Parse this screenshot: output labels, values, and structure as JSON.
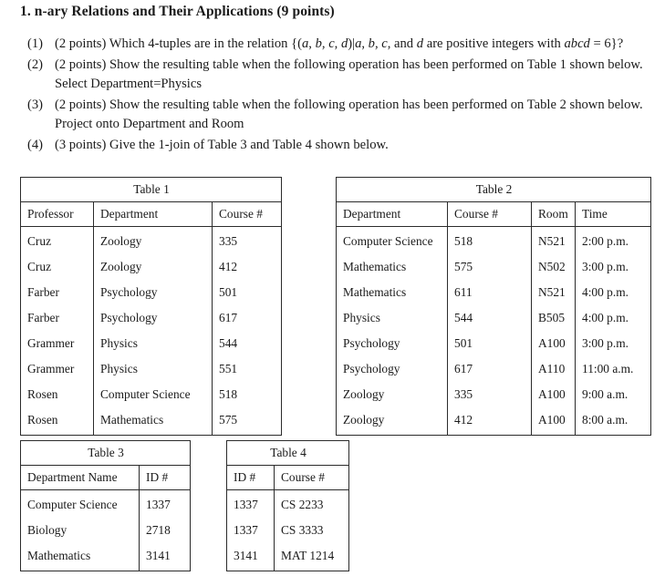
{
  "document": {
    "heading": "1. n-ary Relations and Their Applications (9 points)",
    "problems": [
      {
        "marker": "(1)",
        "points": "(2 points)",
        "text_before": "Which 4-tuples are in the relation {(",
        "vars_tuple_a": "a",
        "sep1": ", ",
        "vars_tuple_b": "b",
        "sep2": ", ",
        "vars_tuple_c": "c",
        "sep3": ", ",
        "vars_tuple_d": "d",
        "text_mid": ")|",
        "cond_a": "a",
        "cond_b": "b",
        "cond_c": "c",
        "cond_and": ", and ",
        "cond_d": "d",
        "text_after": " are positive integers with ",
        "expr": "abcd",
        "expr_tail": " = 6}?",
        "full_text": "(2 points) Which 4-tuples are in the relation {(a, b, c, d)|a, b, c, and d are positive integers with abcd = 6}?"
      },
      {
        "marker": "(2)",
        "points": "(2 points)",
        "full_text": "(2 points) Show the resulting table when the following operation has been performed on Table 1 shown below. Select Department=Physics",
        "line1": "Show the resulting table when the following operation has been performed",
        "line2": "on Table 1 shown below. Select Department=Physics"
      },
      {
        "marker": "(3)",
        "points": "(2 points)",
        "full_text": "(2 points) Show the resulting table when the following operation has been performed on Table 2 shown below. Project onto Department and Room",
        "line1": "Show the resulting table when the following operation has been performed",
        "line2": "on Table 2 shown below. Project onto Department and Room"
      },
      {
        "marker": "(4)",
        "points": "(3 points)",
        "full_text": "(3 points) Give the 1-join of Table 3 and Table 4 shown below.",
        "line1": "Give the 1-join of Table 3 and Table 4 shown below.",
        "line2": ""
      }
    ]
  },
  "tables": {
    "table1": {
      "caption": "Table 1",
      "headers": [
        "Professor",
        "Department",
        "Course #"
      ],
      "rows": [
        [
          "Cruz",
          "Zoology",
          "335"
        ],
        [
          "Cruz",
          "Zoology",
          "412"
        ],
        [
          "Farber",
          "Psychology",
          "501"
        ],
        [
          "Farber",
          "Psychology",
          "617"
        ],
        [
          "Grammer",
          "Physics",
          "544"
        ],
        [
          "Grammer",
          "Physics",
          "551"
        ],
        [
          "Rosen",
          "Computer Science",
          "518"
        ],
        [
          "Rosen",
          "Mathematics",
          "575"
        ]
      ]
    },
    "table2": {
      "caption": "Table 2",
      "headers": [
        "Department",
        "Course #",
        "Room",
        "Time"
      ],
      "rows": [
        [
          "Computer Science",
          "518",
          "N521",
          "2:00 p.m."
        ],
        [
          "Mathematics",
          "575",
          "N502",
          "3:00 p.m."
        ],
        [
          "Mathematics",
          "611",
          "N521",
          "4:00 p.m."
        ],
        [
          "Physics",
          "544",
          "B505",
          "4:00 p.m."
        ],
        [
          "Psychology",
          "501",
          "A100",
          "3:00 p.m."
        ],
        [
          "Psychology",
          "617",
          "A110",
          "11:00 a.m."
        ],
        [
          "Zoology",
          "335",
          "A100",
          "9:00 a.m."
        ],
        [
          "Zoology",
          "412",
          "A100",
          "8:00 a.m."
        ]
      ]
    },
    "table3": {
      "caption": "Table 3",
      "headers": [
        "Department Name",
        "ID #"
      ],
      "rows": [
        [
          "Computer Science",
          "1337"
        ],
        [
          "Biology",
          "2718"
        ],
        [
          "Mathematics",
          "3141"
        ]
      ]
    },
    "table4": {
      "caption": "Table 4",
      "headers": [
        "ID #",
        "Course #"
      ],
      "rows": [
        [
          "1337",
          "CS 2233"
        ],
        [
          "1337",
          "CS 3333"
        ],
        [
          "3141",
          "MAT 1214"
        ]
      ]
    }
  },
  "colors": {
    "page_background": "#ffffff",
    "text": "#1a1a1a",
    "table_border": "#2b2b2b"
  }
}
